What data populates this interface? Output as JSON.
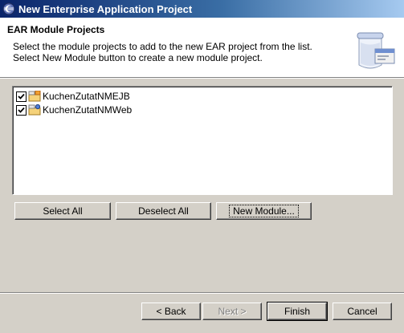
{
  "window": {
    "title": "New Enterprise Application Project"
  },
  "banner": {
    "title": "EAR Module Projects",
    "description_line1": "Select the module projects to add to the new EAR project from the list.",
    "description_line2": "Select New Module button to create a new module project.",
    "icon": "ear-jar-icon"
  },
  "modules": [
    {
      "label": "KuchenZutatNMEJB",
      "checked": true,
      "icon": "project-folder-icon"
    },
    {
      "label": "KuchenZutatNMWeb",
      "checked": true,
      "icon": "project-folder-icon"
    }
  ],
  "module_buttons": {
    "select_all": "Select All",
    "deselect_all": "Deselect All",
    "new_module": "New Module..."
  },
  "wizard_buttons": {
    "back": "< Back",
    "next": "Next >",
    "finish": "Finish",
    "cancel": "Cancel"
  },
  "colors": {
    "titlebar_start": "#0a246a",
    "titlebar_end": "#a6caf0",
    "dialog_bg": "#d4d0c8"
  }
}
